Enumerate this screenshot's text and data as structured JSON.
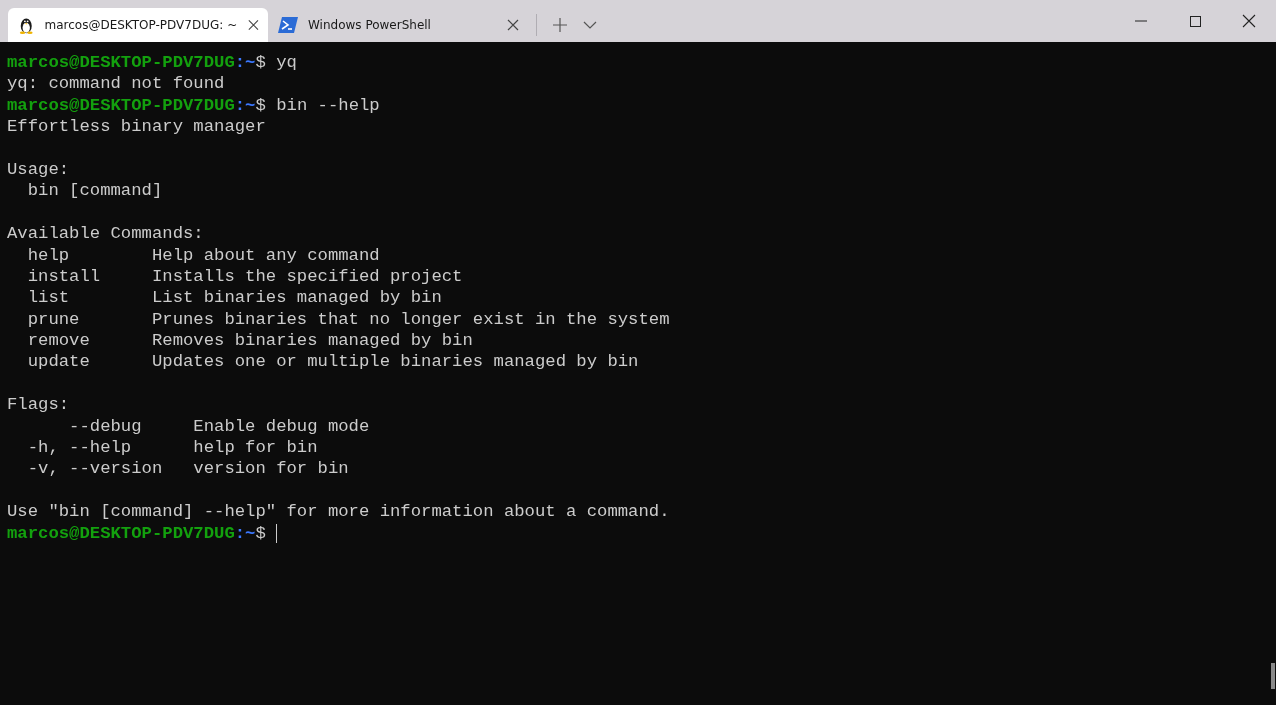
{
  "tabs": [
    {
      "title": "marcos@DESKTOP-PDV7DUG: ~",
      "kind": "linux",
      "selected": true
    },
    {
      "title": "Windows PowerShell",
      "kind": "powershell",
      "selected": false
    }
  ],
  "terminal": {
    "lines": [
      {
        "kind": "prompt",
        "user": "marcos@DESKTOP-PDV7DUG",
        "path": ":~",
        "sign": "$",
        "command": "yq"
      },
      {
        "kind": "output",
        "text": "yq: command not found"
      },
      {
        "kind": "prompt",
        "user": "marcos@DESKTOP-PDV7DUG",
        "path": ":~",
        "sign": "$",
        "command": "bin --help"
      },
      {
        "kind": "output",
        "text": "Effortless binary manager"
      },
      {
        "kind": "blank"
      },
      {
        "kind": "output",
        "text": "Usage:"
      },
      {
        "kind": "output",
        "text": "  bin [command]"
      },
      {
        "kind": "blank"
      },
      {
        "kind": "output",
        "text": "Available Commands:"
      },
      {
        "kind": "output",
        "text": "  help        Help about any command"
      },
      {
        "kind": "output",
        "text": "  install     Installs the specified project"
      },
      {
        "kind": "output",
        "text": "  list        List binaries managed by bin"
      },
      {
        "kind": "output",
        "text": "  prune       Prunes binaries that no longer exist in the system"
      },
      {
        "kind": "output",
        "text": "  remove      Removes binaries managed by bin"
      },
      {
        "kind": "output",
        "text": "  update      Updates one or multiple binaries managed by bin"
      },
      {
        "kind": "blank"
      },
      {
        "kind": "output",
        "text": "Flags:"
      },
      {
        "kind": "output",
        "text": "      --debug     Enable debug mode"
      },
      {
        "kind": "output",
        "text": "  -h, --help      help for bin"
      },
      {
        "kind": "output",
        "text": "  -v, --version   version for bin"
      },
      {
        "kind": "blank"
      },
      {
        "kind": "output",
        "text": "Use \"bin [command] --help\" for more information about a command."
      },
      {
        "kind": "prompt",
        "user": "marcos@DESKTOP-PDV7DUG",
        "path": ":~",
        "sign": "$",
        "cursor": true
      }
    ]
  }
}
